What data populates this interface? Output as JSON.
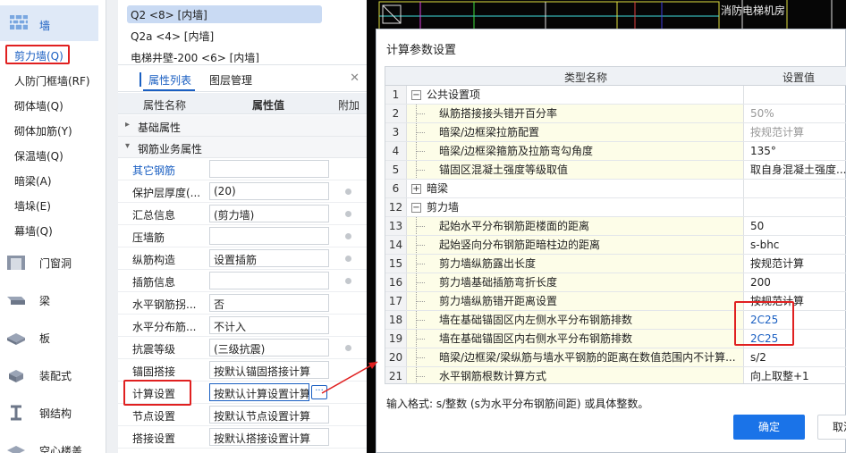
{
  "sidebar": {
    "header_label": "墙",
    "sub_items": [
      "剪力墙(Q)",
      "人防门框墙(RF)",
      "砌体墙(Q)",
      "砌体加筋(Y)",
      "保温墙(Q)",
      "暗梁(A)",
      "墙垛(E)",
      "幕墙(Q)"
    ],
    "categories": [
      "门窗洞",
      "梁",
      "板",
      "装配式",
      "钢结构",
      "空心楼盖"
    ]
  },
  "component_list": {
    "items": [
      "Q2 <8> [内墙]",
      "Q2a <4> [内墙]",
      "电梯井壁-200 <6> [内墙]"
    ]
  },
  "properties": {
    "tabs": [
      "属性列表",
      "图层管理"
    ],
    "columns": [
      "属性名称",
      "属性值",
      "附加"
    ],
    "groups": [
      "基础属性",
      "钢筋业务属性"
    ],
    "rows": [
      {
        "name": "其它钢筋",
        "value": ""
      },
      {
        "name": "保护层厚度(...",
        "value": "(20)"
      },
      {
        "name": "汇总信息",
        "value": "(剪力墙)"
      },
      {
        "name": "压墙筋",
        "value": ""
      },
      {
        "name": "纵筋构造",
        "value": "设置插筋"
      },
      {
        "name": "插筋信息",
        "value": ""
      },
      {
        "name": "水平钢筋拐...",
        "value": "否"
      },
      {
        "name": "水平分布筋...",
        "value": "不计入"
      },
      {
        "name": "抗震等级",
        "value": "(三级抗震)"
      },
      {
        "name": "锚固搭接",
        "value": "按默认锚固搭接计算"
      },
      {
        "name": "计算设置",
        "value": "按默认计算设置计算"
      },
      {
        "name": "节点设置",
        "value": "按默认节点设置计算"
      },
      {
        "name": "搭接设置",
        "value": "按默认搭接设置计算"
      }
    ],
    "more_button": "···"
  },
  "cad": {
    "label": "消防电梯机房"
  },
  "dialog": {
    "title": "计算参数设置",
    "columns": [
      "类型名称",
      "设置值"
    ],
    "rows": [
      {
        "num": "1",
        "name": "公共设置项",
        "value": "",
        "group": "minus"
      },
      {
        "num": "2",
        "name": "纵筋搭接接头错开百分率",
        "value": "50%",
        "style": "gray"
      },
      {
        "num": "3",
        "name": "暗梁/边框梁拉筋配置",
        "value": "按规范计算",
        "style": "gray"
      },
      {
        "num": "4",
        "name": "暗梁/边框梁箍筋及拉筋弯勾角度",
        "value": "135°"
      },
      {
        "num": "5",
        "name": "锚固区混凝土强度等级取值",
        "value": "取自身混凝土强度..."
      },
      {
        "num": "6",
        "name": "暗梁",
        "value": "",
        "group": "plus"
      },
      {
        "num": "12",
        "name": "剪力墙",
        "value": "",
        "group": "minus"
      },
      {
        "num": "13",
        "name": "起始水平分布钢筋距楼面的距离",
        "value": "50"
      },
      {
        "num": "14",
        "name": "起始竖向分布钢筋距暗柱边的距离",
        "value": "s-bhc"
      },
      {
        "num": "15",
        "name": "剪力墙纵筋露出长度",
        "value": "按规范计算"
      },
      {
        "num": "16",
        "name": "剪力墙基础插筋弯折长度",
        "value": "200"
      },
      {
        "num": "17",
        "name": "剪力墙纵筋错开距离设置",
        "value": "按规范计算"
      },
      {
        "num": "18",
        "name": "墙在基础锚固区内左侧水平分布钢筋排数",
        "value": "2C25",
        "style": "blue"
      },
      {
        "num": "19",
        "name": "墙在基础锚固区内右侧水平分布钢筋排数",
        "value": "2C25",
        "style": "blue"
      },
      {
        "num": "20",
        "name": "暗梁/边框梁/梁纵筋与墙水平钢筋的距离在数值范围内不计算...",
        "value": "s/2"
      },
      {
        "num": "21",
        "name": "水平钢筋根数计算方式",
        "value": "向上取整+1"
      }
    ],
    "hint": "输入格式: s/整数 (s为水平分布钢筋间距) 或具体整数。",
    "ok_label": "确定",
    "cancel_label": "取消"
  }
}
